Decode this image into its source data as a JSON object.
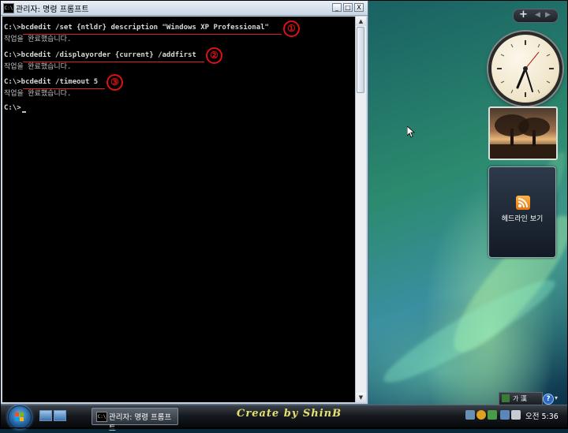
{
  "window": {
    "title": "관리자: 명령 프롬프트",
    "icon_label": "C:\\",
    "buttons": {
      "minimize": "_",
      "maximize": "□",
      "close": "X"
    }
  },
  "console": {
    "lines": [
      {
        "text": "C:\\>bcdedit /set {ntldr} description \"Windows XP Professional\"",
        "type": "command"
      },
      {
        "text": "작업을 완료했습니다.",
        "type": "output"
      },
      {
        "text": "C:\\>bcdedit /displayorder {current} /addfirst",
        "type": "command"
      },
      {
        "text": "작업을 완료했습니다.",
        "type": "output"
      },
      {
        "text": "C:\\>bcdedit /timeout 5",
        "type": "command"
      },
      {
        "text": "작업을 완료했습니다.",
        "type": "output"
      },
      {
        "text": "C:\\>",
        "type": "prompt"
      }
    ],
    "annotations": [
      "①",
      "②",
      "③"
    ],
    "annotation_color": "#e01010"
  },
  "sidebar": {
    "add_button": "+",
    "headlines_label": "헤드라인 보기"
  },
  "taskbar": {
    "task_label": "관리자: 명령 프롬프트",
    "signature": "Create by ShinB",
    "clock": "오전 5:36"
  },
  "language_bar": {
    "label": "가 漢",
    "help": "?"
  },
  "icons": [
    "cmd-icon",
    "windows-logo-icon",
    "rss-icon",
    "clock-gadget",
    "mouse-cursor-icon",
    "help-icon"
  ]
}
